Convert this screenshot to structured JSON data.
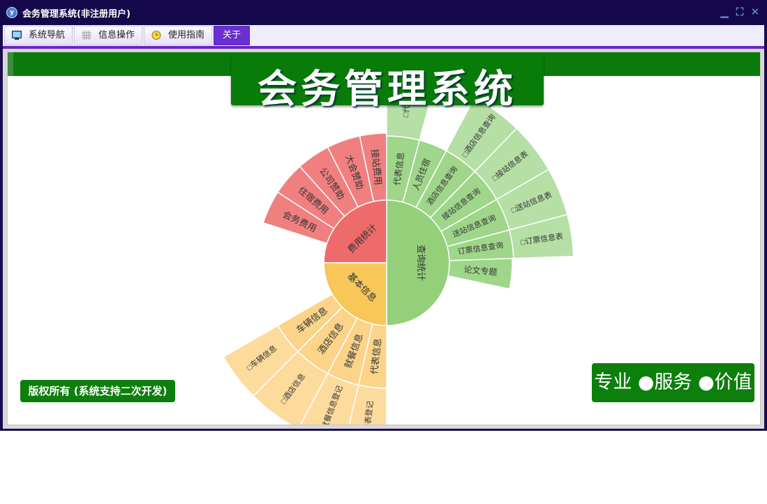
{
  "window": {
    "title": "会务管理系统(非注册用户)",
    "controls": {
      "minimize": "▁",
      "restore": "⛶",
      "close": "✕"
    }
  },
  "menu": {
    "tabs": [
      {
        "label": "系统导航",
        "icon": "monitor-icon"
      },
      {
        "label": "信息操作",
        "icon": "grid-icon"
      },
      {
        "label": "使用指南",
        "icon": "clock-icon"
      },
      {
        "label": "关于",
        "icon": ""
      }
    ],
    "active_tab": "关于"
  },
  "banner": {
    "title": "会务管理系统"
  },
  "footer": {
    "copyright": "版权所有 (系统支持二次开发)",
    "slogan": "专业 ●服务 ●价值"
  },
  "colors": {
    "green_dark": "#0b7a0b",
    "purple_active": "#6b2fd1",
    "red_inner": "#ee6b6b",
    "red_ring": "#f08080",
    "yellow_inner": "#f7c75a",
    "yellow_ring": "#fbd48a",
    "yellow_outer": "#fddb9c",
    "green_inner": "#94cf7a",
    "green_ring": "#9fd68a",
    "green_outer": "#b5dfa5"
  },
  "sunburst": {
    "center": [
      {
        "label": "查询统计",
        "color": "#94cf7a"
      },
      {
        "label": "费用统计",
        "color": "#ee6b6b"
      },
      {
        "label": "基本信息",
        "color": "#f7c75a"
      }
    ],
    "red_ring": [
      "会务费用",
      "住宿费用",
      "公司赞助",
      "大会赞助",
      "接站费用"
    ],
    "yellow_ring": [
      "代表信息",
      "就餐信息",
      "酒店信息",
      "车辆信息"
    ],
    "yellow_outer": [
      "□代表登记",
      "□就餐信息登记",
      "□酒店信息",
      "□车辆信息"
    ],
    "green_ring": [
      "代表信息",
      "人员住宿",
      "酒店信息查询",
      "接站信息查询",
      "送站信息查询",
      "订票信息查询",
      "论文专题"
    ],
    "green_outer": [
      "□代表",
      "□酒店信息查询",
      "□接站信息表",
      "□送站信息表",
      "□订票信息表"
    ]
  }
}
